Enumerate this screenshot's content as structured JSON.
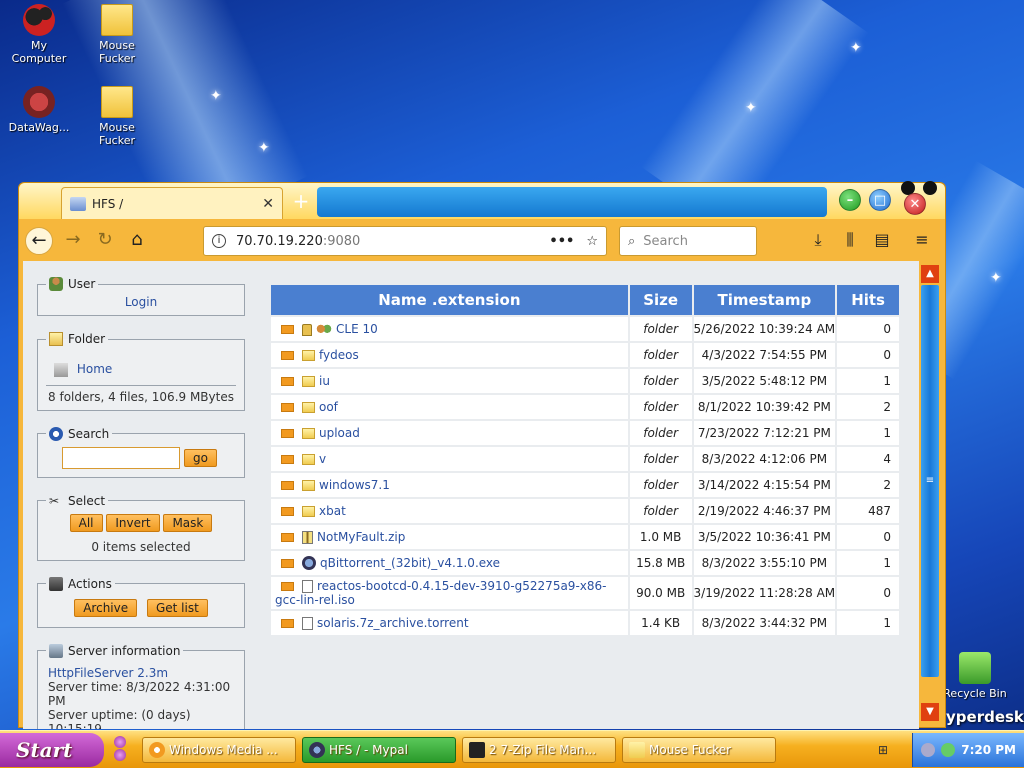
{
  "desktop": {
    "icons": [
      {
        "label": "My\nComputer",
        "icon": "my-computer-icon"
      },
      {
        "label": "Mouse\nFucker",
        "icon": "zip-folder-icon"
      },
      {
        "label": "DataWag...",
        "icon": "datawag-icon"
      },
      {
        "label": "Mouse\nFucker",
        "icon": "folder-icon"
      },
      {
        "label": "Recycle Bin",
        "icon": "recycle-bin-icon"
      }
    ],
    "brand_text": "yperdesk"
  },
  "browser": {
    "tab_title": "HFS /",
    "url_host": "70.70.19.220",
    "url_port": ":9080",
    "search_placeholder": "Search"
  },
  "sidebar": {
    "user": {
      "legend": "User",
      "login_label": "Login"
    },
    "folder": {
      "legend": "Folder",
      "home_label": "Home",
      "summary": "8 folders, 4 files, 106.9 MBytes"
    },
    "search": {
      "legend": "Search",
      "input_value": "",
      "go_label": "go"
    },
    "select": {
      "legend": "Select",
      "all_label": "All",
      "invert_label": "Invert",
      "mask_label": "Mask",
      "selected_text": "0 items selected"
    },
    "actions": {
      "legend": "Actions",
      "archive_label": "Archive",
      "getlist_label": "Get list"
    },
    "server": {
      "legend": "Server information",
      "version_link": "HttpFileServer 2.3m",
      "time_text": "Server time: 8/3/2022 4:31:00 PM",
      "uptime_text": "Server uptime: (0 days) 10:15:19"
    }
  },
  "table": {
    "headers": {
      "name": "Name .extension",
      "size": "Size",
      "timestamp": "Timestamp",
      "hits": "Hits"
    },
    "rows": [
      {
        "name": "CLE 10",
        "type": "locked-folder",
        "size": "folder",
        "timestamp": "5/26/2022 10:39:24 AM",
        "hits": "0"
      },
      {
        "name": "fydeos",
        "type": "folder",
        "size": "folder",
        "timestamp": "4/3/2022 7:54:55 PM",
        "hits": "0"
      },
      {
        "name": "iu",
        "type": "folder",
        "size": "folder",
        "timestamp": "3/5/2022 5:48:12 PM",
        "hits": "1"
      },
      {
        "name": "oof",
        "type": "folder",
        "size": "folder",
        "timestamp": "8/1/2022 10:39:42 PM",
        "hits": "2"
      },
      {
        "name": "upload",
        "type": "folder",
        "size": "folder",
        "timestamp": "7/23/2022 7:12:21 PM",
        "hits": "1"
      },
      {
        "name": "v",
        "type": "folder",
        "size": "folder",
        "timestamp": "8/3/2022 4:12:06 PM",
        "hits": "4"
      },
      {
        "name": "windows7.1",
        "type": "folder",
        "size": "folder",
        "timestamp": "3/14/2022 4:15:54 PM",
        "hits": "2"
      },
      {
        "name": "xbat",
        "type": "folder",
        "size": "folder",
        "timestamp": "2/19/2022 4:46:37 PM",
        "hits": "487"
      },
      {
        "name": "NotMyFault.zip",
        "type": "zip",
        "size": "1.0 MB",
        "timestamp": "3/5/2022 10:36:41 PM",
        "hits": "0"
      },
      {
        "name": "qBittorrent_(32bit)_v4.1.0.exe",
        "type": "exe",
        "size": "15.8 MB",
        "timestamp": "8/3/2022 3:55:10 PM",
        "hits": "1"
      },
      {
        "name": "reactos-bootcd-0.4.15-dev-3910-g52275a9-x86-gcc-lin-rel.iso",
        "type": "file",
        "size": "90.0 MB",
        "timestamp": "3/19/2022 11:28:28 AM",
        "hits": "0"
      },
      {
        "name": "solaris.7z_archive.torrent",
        "type": "file",
        "size": "1.4 KB",
        "timestamp": "8/3/2022 3:44:32 PM",
        "hits": "1"
      }
    ]
  },
  "taskbar": {
    "start_label": "Start",
    "tasks": [
      {
        "label": "Windows Media ..."
      },
      {
        "label": "HFS / - Mypal"
      },
      {
        "label": "2 7-Zip File Man..."
      },
      {
        "label": "Mouse Fucker"
      }
    ],
    "clock": "7:20 PM"
  },
  "colors": {
    "table_header": "#4a7fd0",
    "browser_chrome": "#f6b73c",
    "link": "#2a50a0",
    "taskbar": "#f6b020"
  }
}
